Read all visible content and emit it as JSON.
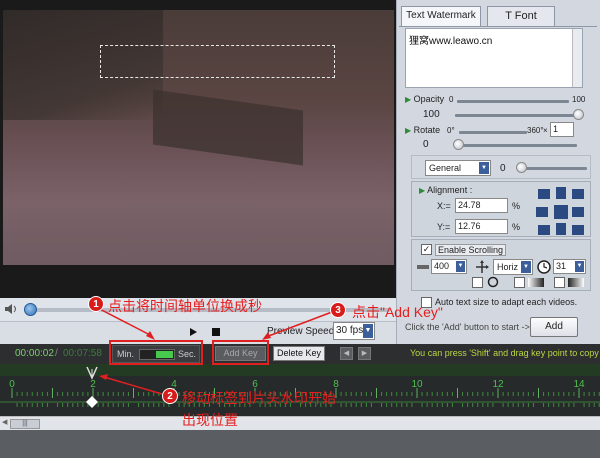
{
  "preview": {
    "speed_label": "Preview Speed:",
    "speed_value": "30 fps/s"
  },
  "timeline": {
    "current_time": "00:00:02",
    "separator": "/",
    "total_time": "00:07:58",
    "unit_min": "Min.",
    "unit_sec": "Sec.",
    "add_key": "Add Key",
    "delete_key": "Delete Key",
    "hint": "You can press 'Shift' and drag key point to copy th",
    "ticks": [
      "0",
      "2",
      "4",
      "6",
      "8",
      "10",
      "12",
      "14"
    ],
    "scroll_thumb": "|||"
  },
  "panel": {
    "tab_watermark": "Text Watermark",
    "tab_font": "T Font",
    "watermark_text": "狸窝www.leawo.cn",
    "opacity_label": "Opacity",
    "opacity_min": "0",
    "opacity_max": "100",
    "opacity_value": "100",
    "rotate_label": "Rotate",
    "rotate_min": "0°",
    "rotate_max": "360°",
    "rotate_mult": "1",
    "rotate_value": "0",
    "mode_select": "General",
    "mode_value": "0",
    "alignment_label": "Alignment :",
    "x_label": "X:=",
    "x_value": "24.78",
    "y_label": "Y:=",
    "y_value": "12.76",
    "percent": "%",
    "scrolling_label": "Enable Scrolling",
    "scroll_speed": "400",
    "scroll_dir": "Horiz",
    "scroll_time": "31",
    "autosize_label": "Auto text size to adapt each videos.",
    "add_hint": "Click the 'Add' button to start ->",
    "add_button": "Add"
  },
  "annotations": {
    "a1_num": "1",
    "a1_text": "点击将时间轴单位换成秒",
    "a2_num": "2",
    "a2_text_line1": "移动标签到片头水印开始",
    "a2_text_line2": "出现位置",
    "a3_num": "3",
    "a3_text": "点击\"Add Key\""
  },
  "colors": {
    "annotation_red": "#e02020",
    "timeline_bg": "#262a2a",
    "accent_green": "#47c94d"
  }
}
